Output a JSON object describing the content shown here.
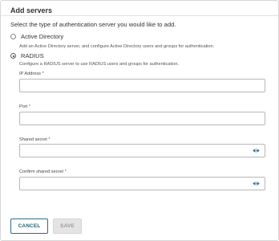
{
  "dialog": {
    "title": "Add servers",
    "prompt": "Select the type of authentication server you would like to add."
  },
  "options": [
    {
      "label": "Active Directory",
      "description": "Add an Active Directory server, and configure Active Directory users and groups for authentication.",
      "selected": false
    },
    {
      "label": "RADIUS",
      "description": "Configure a RADIUS server to use RADIUS users and groups for authentication.",
      "selected": true
    }
  ],
  "fields": {
    "ip_address": {
      "label": "IP Address",
      "required_mark": "*",
      "value": ""
    },
    "port": {
      "label": "Port",
      "required_mark": "*",
      "value": ""
    },
    "shared_secret": {
      "label": "Shared secret",
      "required_mark": "*",
      "value": "",
      "icon": "eye-icon"
    },
    "confirm_shared_secret": {
      "label": "Confirm shared secret",
      "required_mark": "*",
      "value": "",
      "icon": "eye-icon"
    }
  },
  "buttons": {
    "cancel": "CANCEL",
    "save": "SAVE"
  },
  "colors": {
    "accent": "#2b6f88",
    "eye_icon": "#1f6e8c",
    "required": "#c0392b",
    "disabled_bg": "#e4e4e4"
  }
}
